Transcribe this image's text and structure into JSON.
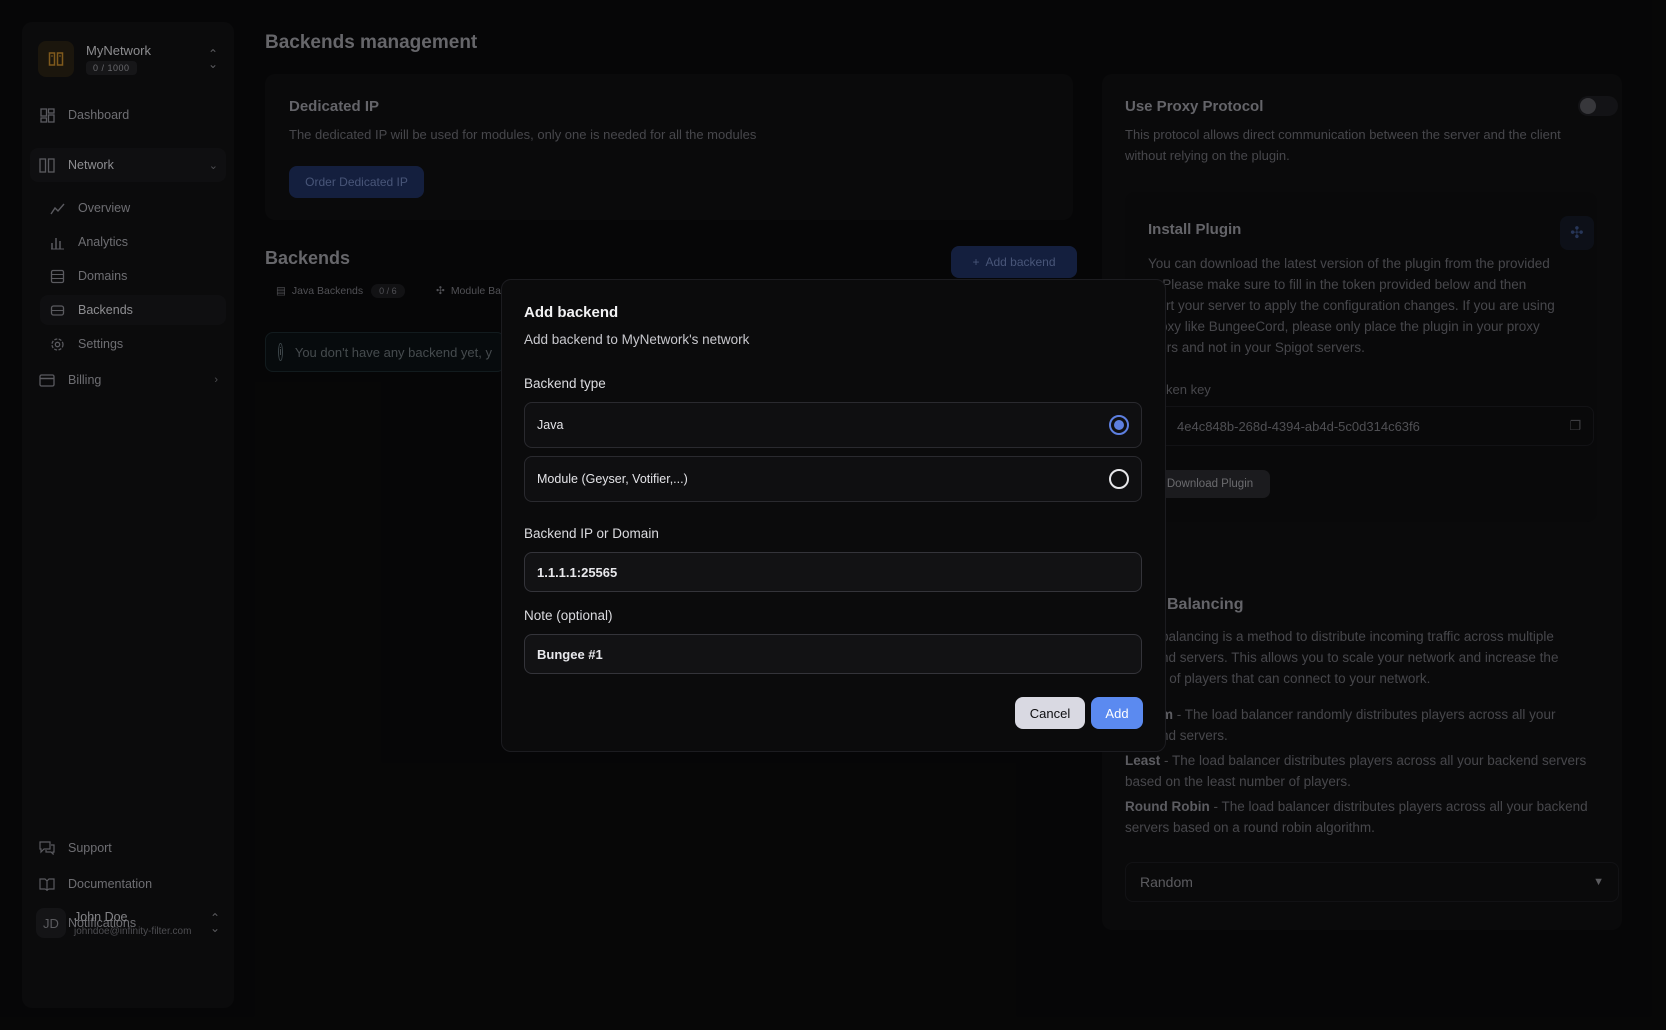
{
  "sidebar": {
    "org": {
      "name": "MyNetwork",
      "badge": "0 / 1000"
    },
    "items": {
      "dashboard": "Dashboard",
      "network": "Network",
      "overview": "Overview",
      "analytics": "Analytics",
      "domains": "Domains",
      "backends": "Backends",
      "settings": "Settings",
      "billing": "Billing",
      "support": "Support",
      "documentation": "Documentation",
      "notifications": "Notifications"
    },
    "user": {
      "initials": "JD",
      "name": "John Doe",
      "email": "johndoe@infinity-filter.com"
    }
  },
  "main": {
    "title": "Backends management",
    "dedicated": {
      "title": "Dedicated IP",
      "desc": "The dedicated IP will be used for modules, only one is needed for all the modules",
      "button": "Order Dedicated IP"
    },
    "backends": {
      "title": "Backends",
      "add_button": "Add backend",
      "tabs": [
        {
          "label": "Java Backends",
          "count": "0 / 6"
        },
        {
          "label": "Module Ba"
        }
      ],
      "alert": "You don't have any backend yet, y"
    }
  },
  "right": {
    "proxy": {
      "title": "Use Proxy Protocol",
      "desc": "This protocol allows direct communication between the server and the client without relying on the plugin."
    },
    "plugin": {
      "title": "Install Plugin",
      "desc_lines": [
        "You can download the latest version of the plugin from the provided",
        "k. Please make sure to fill in the token provided below and then",
        "start your server to apply the configuration changes. If you are using",
        "proxy like BungeeCord, please only place the plugin in your proxy",
        "rvers and not in your Spigot servers."
      ],
      "token_label": "ken key",
      "token_value": "4e4c848b-268d-4394-ab4d-5c0d314c63f6",
      "download": "Download Plugin"
    },
    "lb": {
      "title": "Balancing",
      "desc_lines": [
        "balancing is a method to distribute incoming traffic across multiple",
        "nd servers. This allows you to scale your network and increase the",
        "r of players that can connect to your network."
      ],
      "random_term": "m",
      "random_desc": " - The load balancer randomly distributes players across all your",
      "random_desc2": "nd servers.",
      "least_term": "Least",
      "least_desc": " - The load balancer distributes players across all your backend servers",
      "least_desc2": "based on the least number of players.",
      "rr_term": "Round Robin",
      "rr_desc": " - The load balancer distributes players across all your backend",
      "rr_desc2": "servers based on a round robin algorithm.",
      "selected": "Random"
    }
  },
  "modal": {
    "title": "Add backend",
    "subtitle": "Add backend to MyNetwork's network",
    "type_label": "Backend type",
    "options": [
      {
        "label": "Java",
        "checked": true
      },
      {
        "label": "Module (Geyser, Votifier,...)",
        "checked": false
      }
    ],
    "ip_label": "Backend IP or Domain",
    "ip_value": "1.1.1.1:25565",
    "note_label": "Note (optional)",
    "note_value": "Bungee #1",
    "cancel": "Cancel",
    "add": "Add"
  },
  "colors": {
    "accent": "#5b8af0",
    "brand": "#c58a2d"
  }
}
